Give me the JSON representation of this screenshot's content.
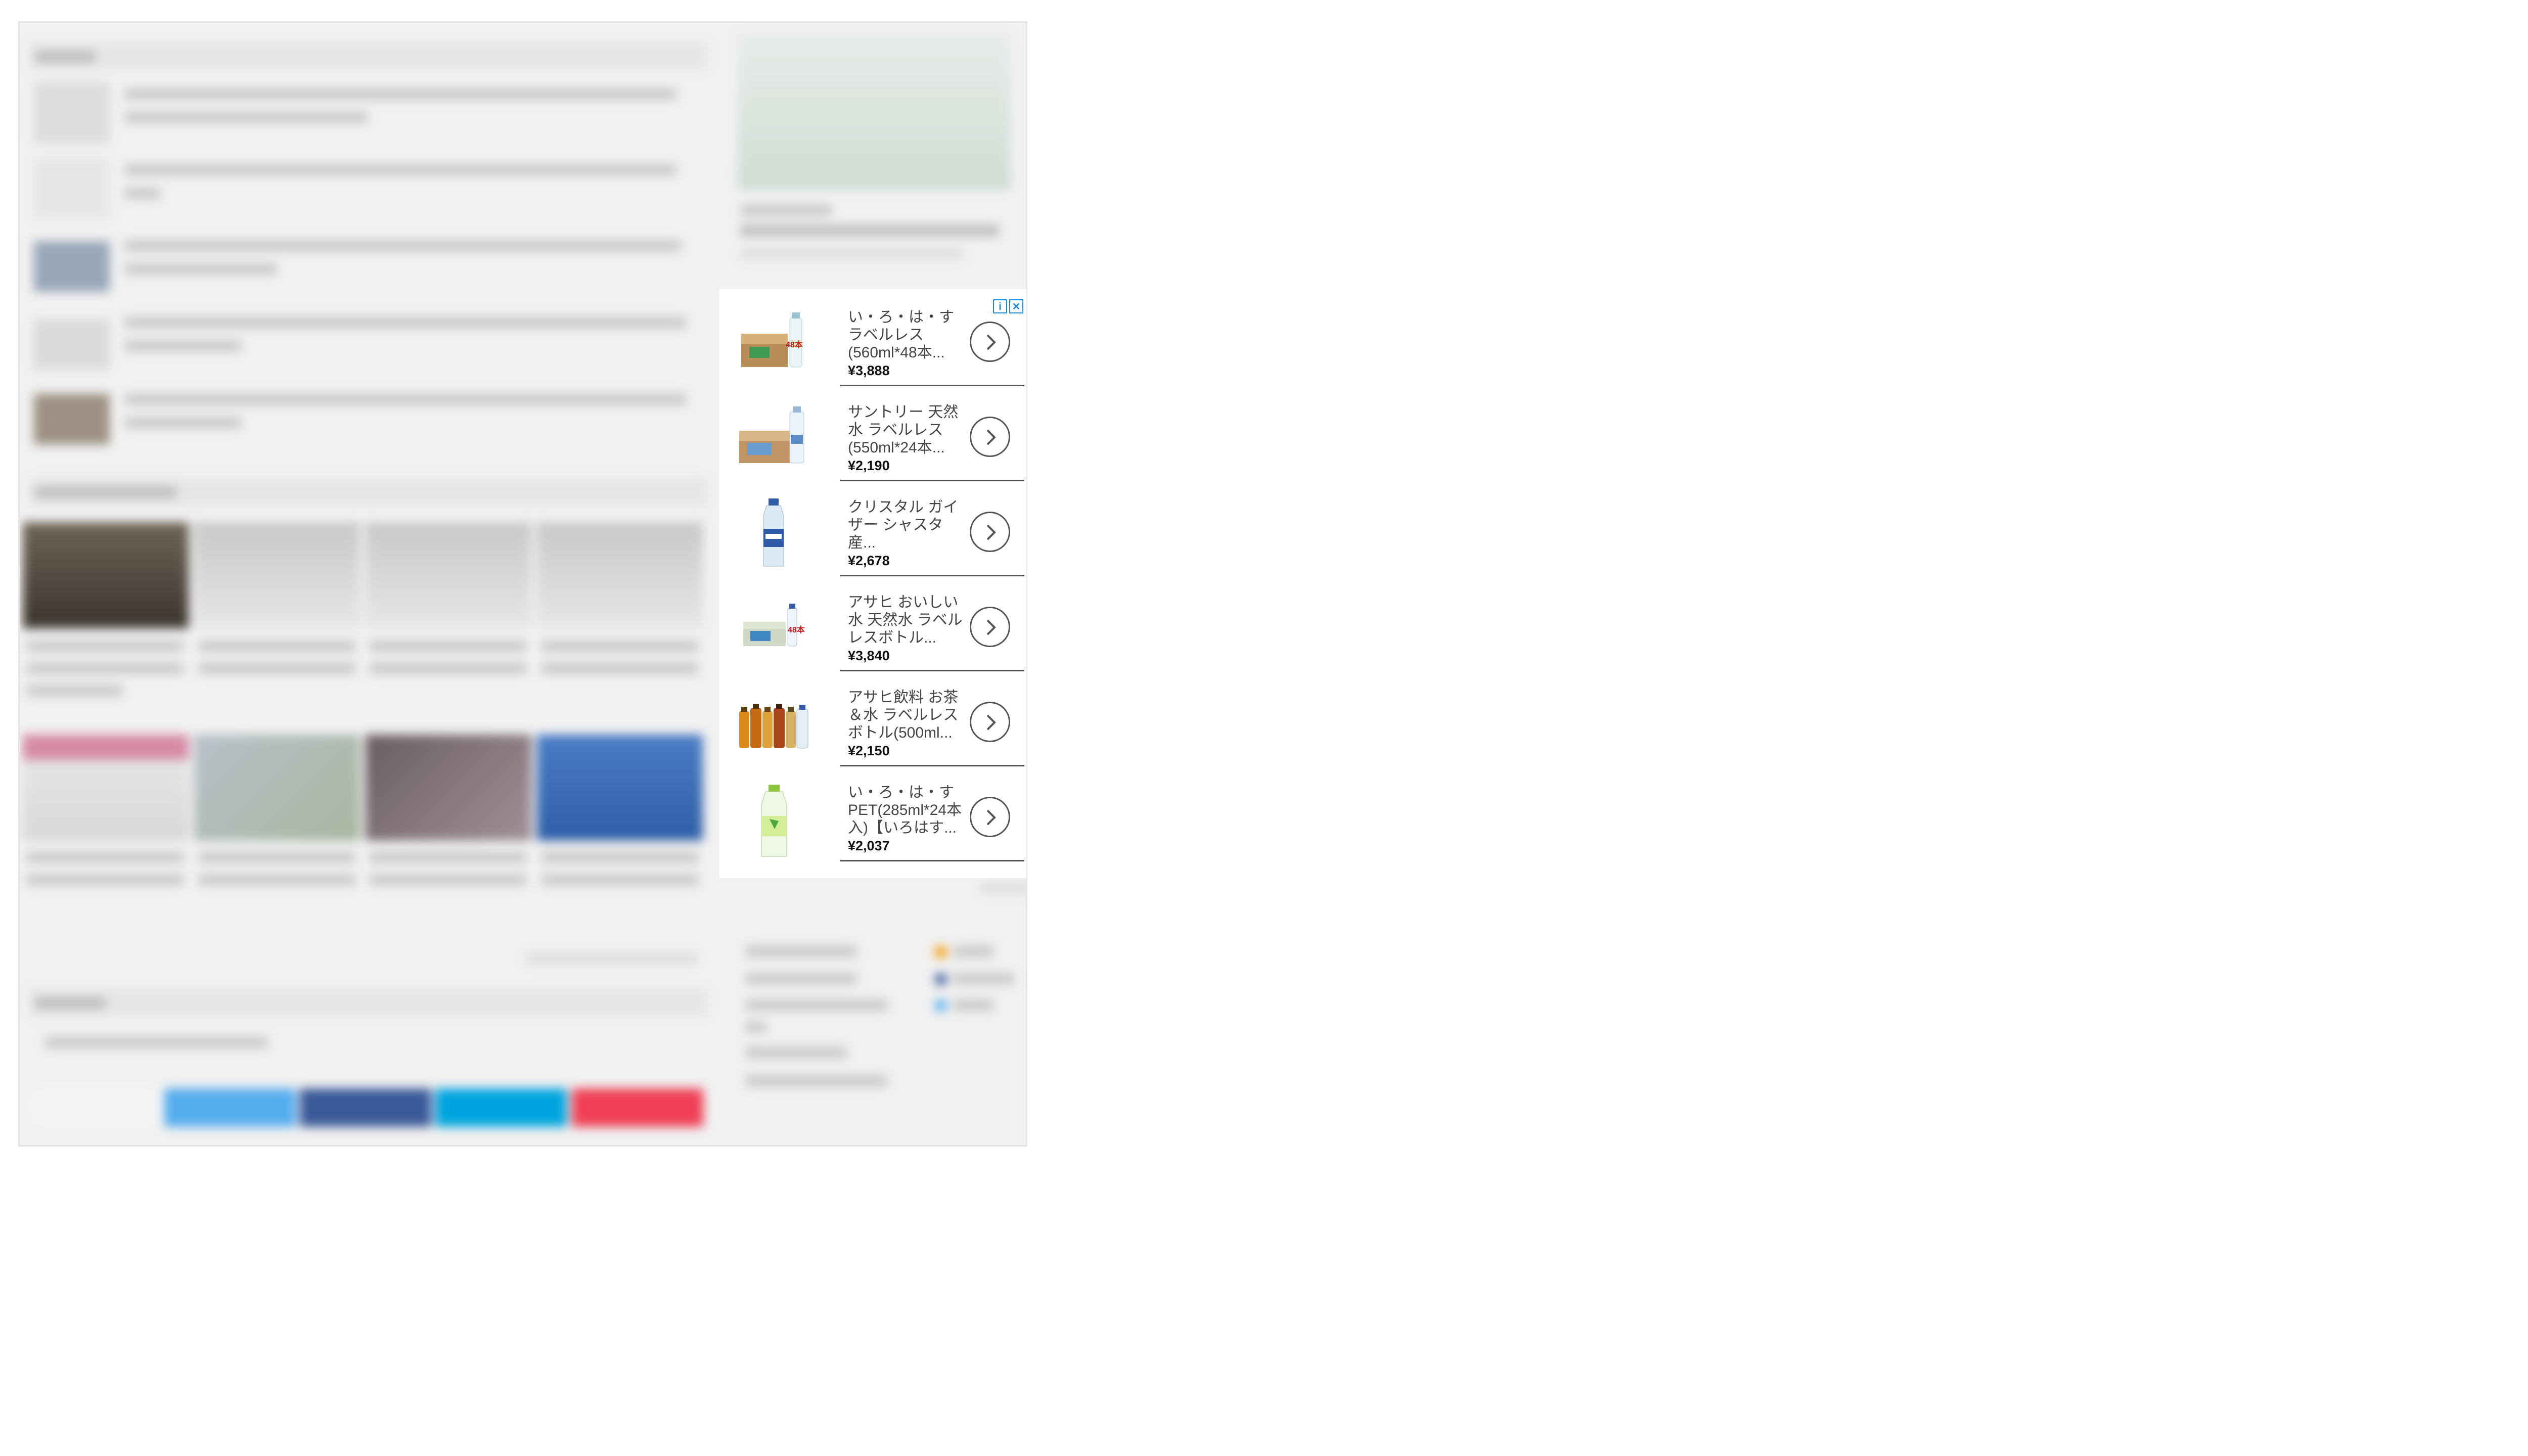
{
  "ad": {
    "badges": {
      "info": "i",
      "close": "✕"
    },
    "items": [
      {
        "title": "い・ろ・は・す ラベルレス (560ml*48本...",
        "price": "¥3,888",
        "image_label": "48本"
      },
      {
        "title": "サントリー 天然水 ラベルレス (550ml*24本...",
        "price": "¥2,190"
      },
      {
        "title": "クリスタル ガイザー シャスタ産...",
        "price": "¥2,678"
      },
      {
        "title": "アサヒ おいしい水 天然水 ラベルレスボトル...",
        "price": "¥3,840",
        "image_label": "48本"
      },
      {
        "title": "アサヒ飲料 お茶＆水 ラベルレスボトル(500ml...",
        "price": "¥2,150"
      },
      {
        "title": "い・ろ・は・す PET(285ml*24本入)【いろはす...",
        "price": "¥2,037"
      }
    ]
  },
  "colors": {
    "accent": "#1a8ad6",
    "twitter": "#55acee",
    "facebook": "#3b5998",
    "hatena": "#00a4de",
    "pocket": "#ef4056",
    "background": "#f1f1f1"
  }
}
